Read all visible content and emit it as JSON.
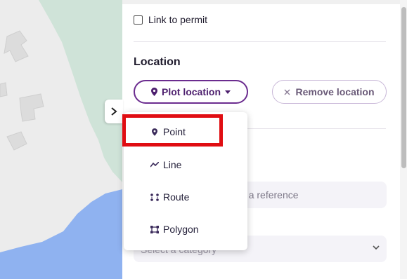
{
  "map": {
    "collapse_icon": "chevron-right-icon"
  },
  "panel": {
    "link_to_permit_label": "Link to permit",
    "location_title": "Location",
    "plot_location_label": "Plot location",
    "remove_location_label": "Remove location",
    "reference_placeholder_visible": "tan or a reference",
    "category_placeholder_visible": "Select a category"
  },
  "dropdown": {
    "items": [
      {
        "label": "Point",
        "icon": "map-pin-icon"
      },
      {
        "label": "Line",
        "icon": "line-icon"
      },
      {
        "label": "Route",
        "icon": "route-icon"
      },
      {
        "label": "Polygon",
        "icon": "polygon-icon"
      }
    ],
    "highlighted_item": "Point"
  },
  "colors": {
    "accent_purple": "#6b2c8f",
    "highlight_red": "#e00d12",
    "map_water": "#8fb2f0",
    "map_green": "#cfe3d8"
  }
}
